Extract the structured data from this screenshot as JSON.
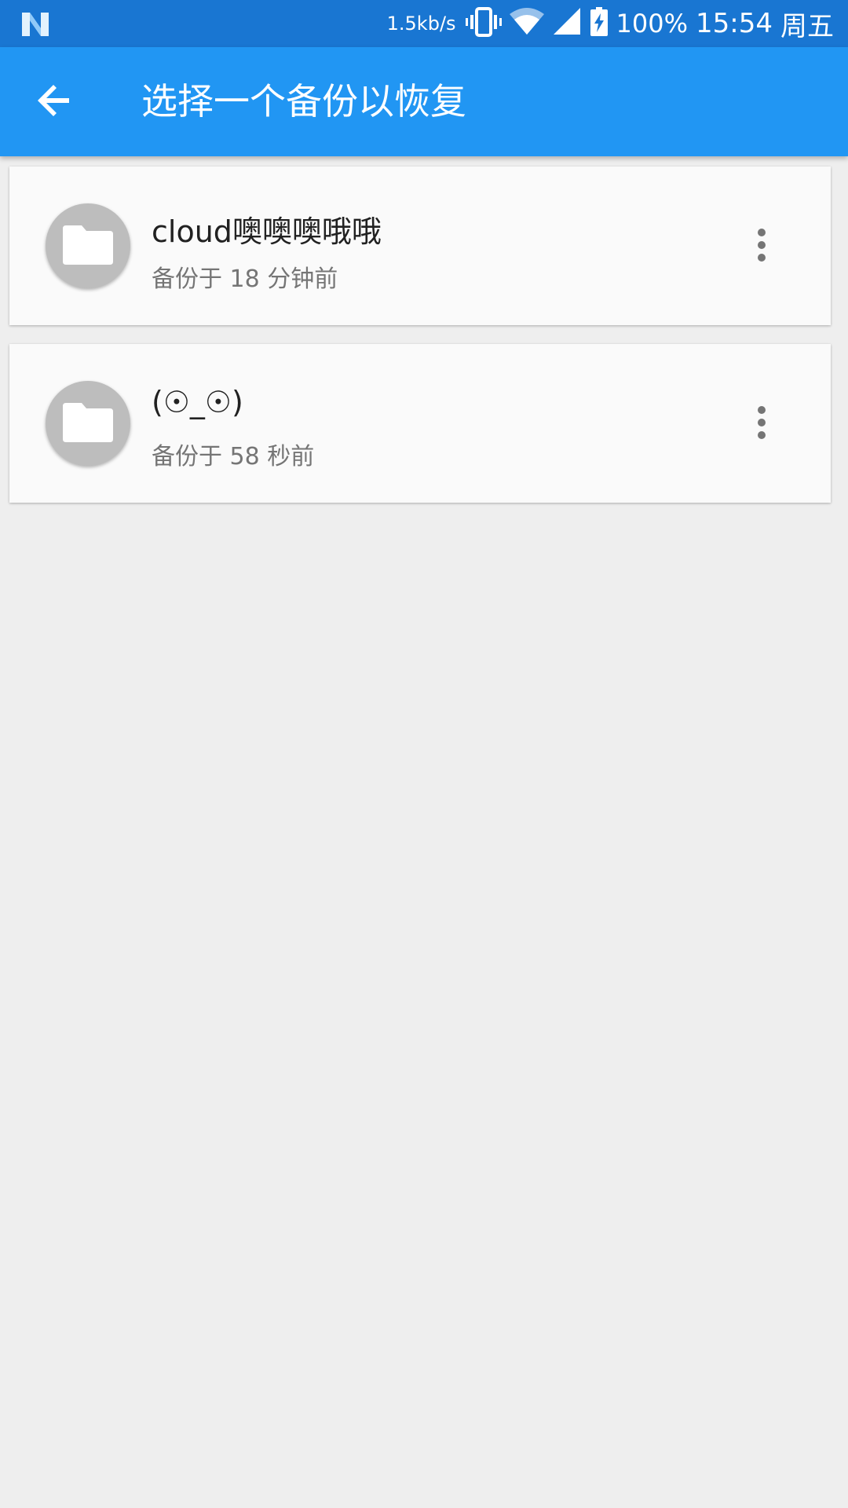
{
  "status_bar": {
    "logo_icon": "android-n-icon",
    "net_speed": "1.5kb/s",
    "icons": [
      "vibrate-icon",
      "wifi-icon",
      "signal-icon",
      "battery-charging-icon"
    ],
    "battery": "100%",
    "time": "15:54",
    "day": "周五",
    "color": "#1976d2"
  },
  "app_bar": {
    "back_icon": "arrow-back-icon",
    "title": "选择一个备份以恢复",
    "color": "#2196f3"
  },
  "backups": [
    {
      "name": "cloud噢噢噢哦哦",
      "subtitle": "备份于 18 分钟前",
      "icon": "folder-icon",
      "menu_icon": "more-vert-icon"
    },
    {
      "name": "(☉_☉)",
      "subtitle": "备份于 58 秒前",
      "icon": "folder-icon",
      "menu_icon": "more-vert-icon"
    }
  ]
}
